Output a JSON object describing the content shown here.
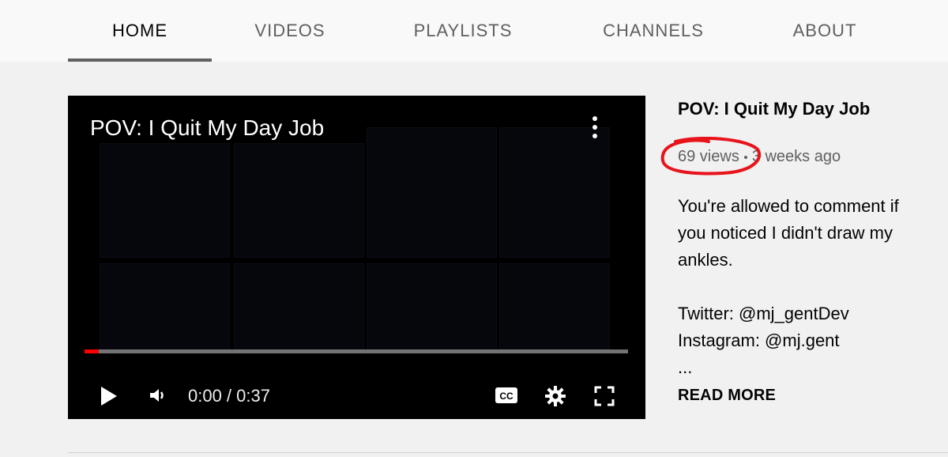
{
  "tabs": [
    {
      "label": "HOME",
      "active": true
    },
    {
      "label": "VIDEOS",
      "active": false
    },
    {
      "label": "PLAYLISTS",
      "active": false
    },
    {
      "label": "CHANNELS",
      "active": false
    },
    {
      "label": "ABOUT",
      "active": false
    }
  ],
  "player": {
    "title": "POV: I Quit My Day Job",
    "time": "0:00 / 0:37",
    "progress_fraction": 0.026,
    "icons": [
      "more-vert-icon",
      "play-icon",
      "volume-icon",
      "captions-icon",
      "settings-icon",
      "fullscreen-icon"
    ],
    "accent": "#ff0000"
  },
  "video": {
    "title": "POV: I Quit My Day Job",
    "views": "69 views",
    "age": "3 weeks ago",
    "description_lines": [
      "You're allowed to comment if",
      "you noticed I didn't draw my",
      "ankles.",
      "",
      "Twitter: @mj_gentDev",
      "Instagram: @mj.gent",
      "..."
    ],
    "read_more": "READ MORE"
  },
  "annotation_color": "#e8141b"
}
